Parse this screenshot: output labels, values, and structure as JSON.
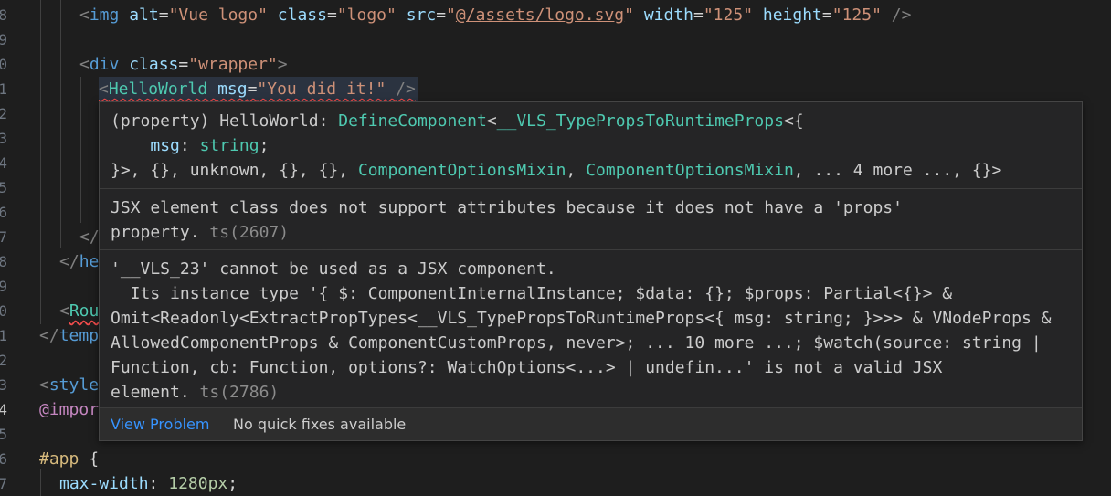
{
  "gutter": {
    "line_numbers": [
      "8",
      "9",
      "0",
      "1",
      "2",
      "3",
      "4",
      "5",
      "6",
      "7",
      "8",
      "9",
      "0",
      "1",
      "2",
      "3",
      "4",
      "5",
      "6",
      "7"
    ]
  },
  "code": {
    "img_tag": "img",
    "img_alt_attr": "alt",
    "img_alt_val": "\"Vue logo\"",
    "img_class_attr": "class",
    "img_class_val": "\"logo\"",
    "img_src_attr": "src",
    "img_src_val_q1": "\"",
    "img_src_val_path": "@/assets/logo.svg",
    "img_src_val_q2": "\"",
    "img_width_attr": "width",
    "img_width_val": "\"125\"",
    "img_height_attr": "height",
    "img_height_val": "\"125\"",
    "div_tag": "div",
    "div_class_attr": "class",
    "div_class_val": "\"wrapper\"",
    "hw_tag": "HelloWorld",
    "hw_msg_attr": "msg",
    "hw_msg_val": "\"You did it!\"",
    "close_div_partial": "</",
    "close_header_tag": "he",
    "router_tag": "Rou",
    "close_template_tag": "temp",
    "style_tag": "style",
    "import_kw": "@impor",
    "app_selector": "#app",
    "brace_open": "{",
    "maxw_prop": "max-width",
    "maxw_val": "1280px"
  },
  "hover": {
    "sig_line1": {
      "part1": "(property) HelloWorld: ",
      "type1": "DefineComponent",
      "part2": "<",
      "type2": "__VLS_TypePropsToRuntimeProps",
      "part3": "<{"
    },
    "sig_line2": {
      "indent": "    ",
      "prop": "msg",
      "colon": ": ",
      "type": "string",
      "semi": ";"
    },
    "sig_line3": {
      "part1": "}>, {}, unknown, {}, {}, ",
      "type1": "ComponentOptionsMixin",
      "part2": ", ",
      "type2": "ComponentOptionsMixin",
      "part3": ", ... 4 more ..., {}>"
    },
    "msg1_line1": "JSX element class does not support attributes because it does not have a 'props'",
    "msg1_line2": "property.",
    "msg1_code": "ts(2607)",
    "msg2_lines": [
      "'__VLS_23' cannot be used as a JSX component.",
      "  Its instance type '{ $: ComponentInternalInstance; $data: {}; $props: Partial<{}> &",
      "Omit<Readonly<ExtractPropTypes<__VLS_TypePropsToRuntimeProps<{ msg: string; }>>> & VNodeProps &",
      "AllowedComponentProps & ComponentCustomProps, never>; ... 10 more ...; $watch(source: string |",
      "Function, cb: Function, options?: WatchOptions<...> | undefin...' is not a valid JSX"
    ],
    "msg2_last": "element.",
    "msg2_code": "ts(2786)",
    "status": {
      "view_problem": "View Problem",
      "no_fixes": "No quick fixes available"
    }
  }
}
